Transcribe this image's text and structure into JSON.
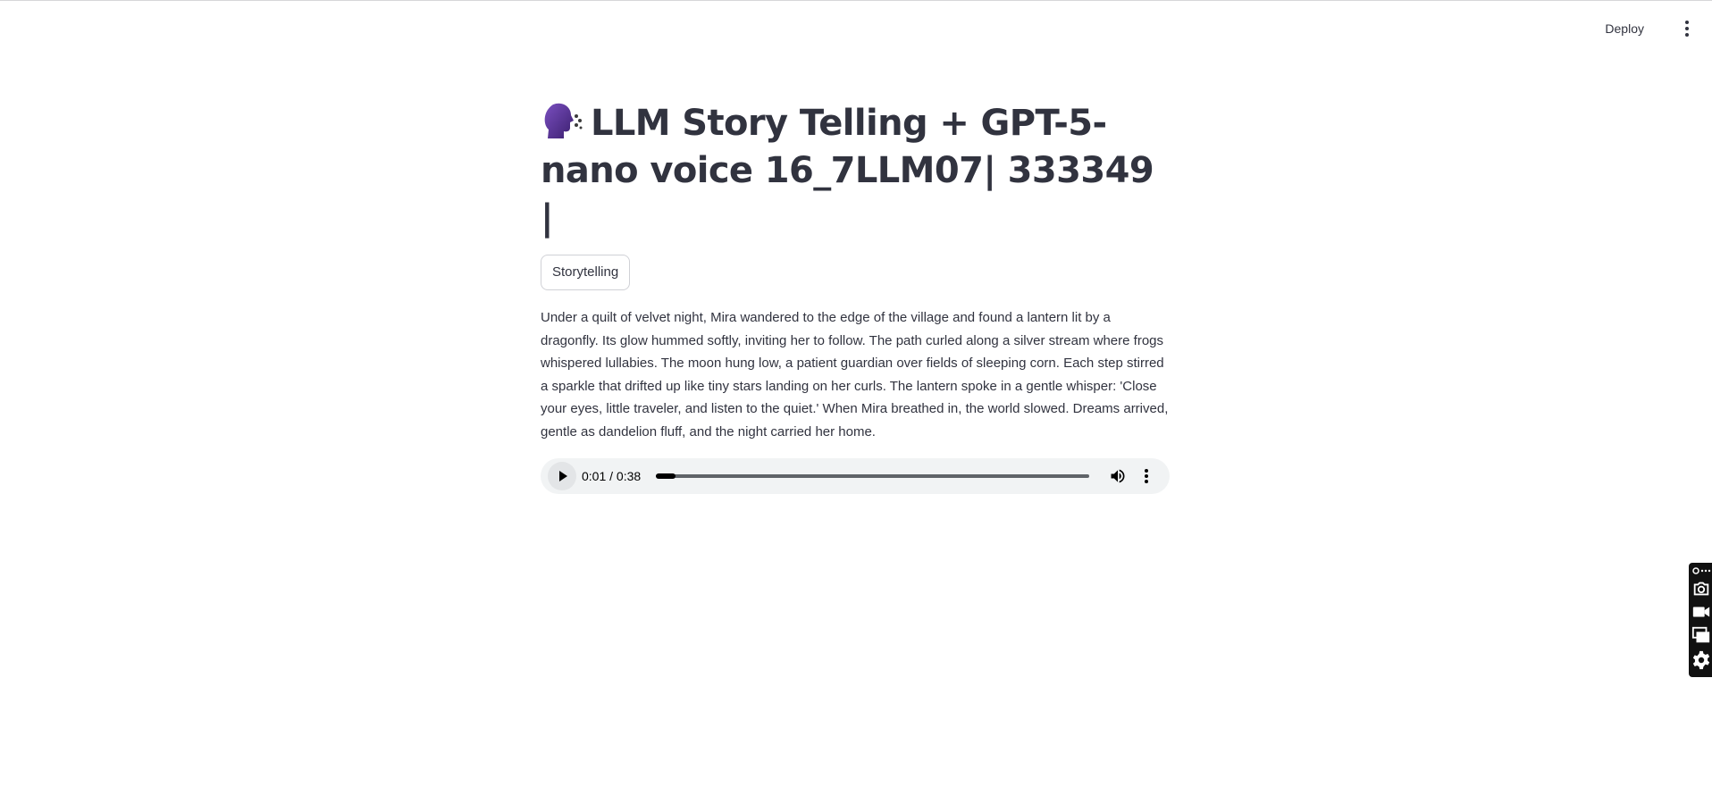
{
  "header": {
    "deploy_label": "Deploy"
  },
  "main": {
    "title_icon": "speaking-head-icon",
    "title": "LLM Story Telling + GPT-5-nano voice 16_7LLM07| 333349 |",
    "tag_label": "Storytelling",
    "story": "Under a quilt of velvet night, Mira wandered to the edge of the village and found a lantern lit by a dragonfly. Its glow hummed softly, inviting her to follow. The path curled along a silver stream where frogs whispered lullabies. The moon hung low, a patient guardian over fields of sleeping corn. Each step stirred a sparkle that drifted up like tiny stars landing on her curls. The lantern spoke in a gentle whisper: 'Close your eyes, little traveler, and listen to the quiet.' When Mira breathed in, the world slowed. Dreams arrived, gentle as dandelion fluff, and the night carried her home."
  },
  "audio_player": {
    "time": "0:01 / 0:38",
    "progress_fraction": 0.045,
    "icons": [
      "play-icon",
      "volume-icon",
      "more-options-icon"
    ]
  },
  "side_toolbar": {
    "icons": [
      "link-icon",
      "camera-icon",
      "video-camera-icon",
      "screens-icon",
      "settings-icon"
    ]
  }
}
